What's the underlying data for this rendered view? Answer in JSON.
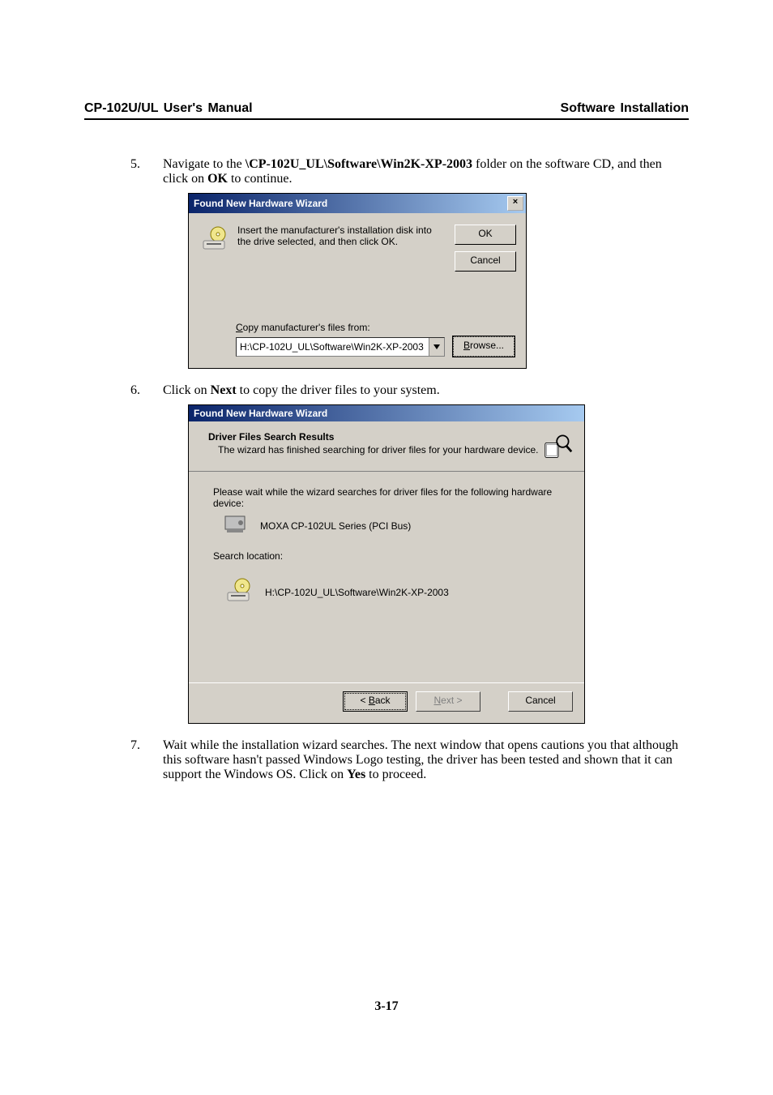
{
  "header": {
    "left": "CP-102U/UL  User's  Manual",
    "right": "Software  Installation"
  },
  "step5": {
    "num": "5.",
    "text_a": "Navigate to the ",
    "path": "\\CP-102U_UL\\Software\\Win2K-XP-2003",
    "text_b": " folder on the software CD, and then click on ",
    "ok": "OK",
    "text_c": " to continue."
  },
  "dialog1": {
    "title": "Found New Hardware Wizard",
    "message": "Insert the manufacturer's installation disk into the drive selected, and then click OK.",
    "ok_label": "OK",
    "cancel_label": "Cancel",
    "copy_label": "Copy manufacturer's files from:",
    "path_value": "H:\\CP-102U_UL\\Software\\Win2K-XP-2003",
    "browse_label": "Browse..."
  },
  "step6": {
    "num": "6.",
    "text_a": "Click on ",
    "next": "Next",
    "text_b": " to copy the driver files to your system."
  },
  "dialog2": {
    "title": "Found New Hardware Wizard",
    "headline": "Driver Files Search Results",
    "subline": "The wizard has finished searching for driver files for your hardware device.",
    "wait_text": "Please wait while the wizard searches for driver files for the following hardware device:",
    "device_name": "MOXA CP-102UL Series (PCI Bus)",
    "search_loc_label": "Search location:",
    "search_path": "H:\\CP-102U_UL\\Software\\Win2K-XP-2003",
    "back_label": "< Back",
    "next_label": "Next >",
    "cancel_label": "Cancel"
  },
  "step7": {
    "num": "7.",
    "text_a": "Wait while the installation wizard searches. The next window that opens cautions you that although this software hasn't passed Windows Logo testing, the driver has been tested and shown that it can support the Windows OS. Click on ",
    "yes": "Yes",
    "text_b": " to proceed."
  },
  "page_number": "3-17"
}
